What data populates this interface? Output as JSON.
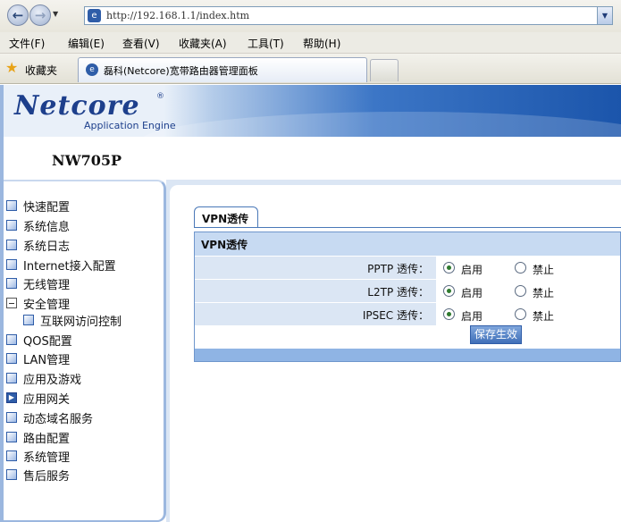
{
  "browser": {
    "address_url": "http://192.168.1.1/index.htm",
    "menu": [
      "文件(F)",
      "编辑(E)",
      "查看(V)",
      "收藏夹(A)",
      "工具(T)",
      "帮助(H)"
    ],
    "favorites_label": "收藏夹",
    "tab_title": "磊科(Netcore)宽带路由器管理面板"
  },
  "header": {
    "logo_text": "Netcore",
    "logo_sub": "Application Engine",
    "model": "NW705P"
  },
  "sidebar": {
    "items": [
      {
        "label": "快速配置",
        "icon": "page-icon"
      },
      {
        "label": "系统信息",
        "icon": "page-icon"
      },
      {
        "label": "系统日志",
        "icon": "page-icon"
      },
      {
        "label": "Internet接入配置",
        "icon": "page-icon"
      },
      {
        "label": "无线管理",
        "icon": "page-icon"
      },
      {
        "label": "安全管理",
        "icon": "collapse-icon"
      },
      {
        "label": "互联网访问控制",
        "icon": "page-icon"
      },
      {
        "label": "QOS配置",
        "icon": "page-icon"
      },
      {
        "label": "LAN管理",
        "icon": "page-icon"
      },
      {
        "label": "应用及游戏",
        "icon": "page-icon"
      },
      {
        "label": "应用网关",
        "icon": "arrow-right-icon"
      },
      {
        "label": "动态域名服务",
        "icon": "page-icon"
      },
      {
        "label": "路由配置",
        "icon": "page-icon"
      },
      {
        "label": "系统管理",
        "icon": "page-icon"
      },
      {
        "label": "售后服务",
        "icon": "page-icon"
      }
    ]
  },
  "vpn": {
    "tab_label": "VPN透传",
    "section_title": "VPN透传",
    "rows": [
      {
        "label": "PPTP 透传：",
        "enable": "启用",
        "disable": "禁止",
        "selected": "enable"
      },
      {
        "label": "L2TP 透传：",
        "enable": "启用",
        "disable": "禁止",
        "selected": "enable"
      },
      {
        "label": "IPSEC 透传：",
        "enable": "启用",
        "disable": "禁止",
        "selected": "enable"
      }
    ],
    "save_label": "保存生效"
  },
  "colors": {
    "accent": "#2f5da8",
    "panel_bg": "#dbe6f4",
    "header_bg": "#c7daf2"
  }
}
